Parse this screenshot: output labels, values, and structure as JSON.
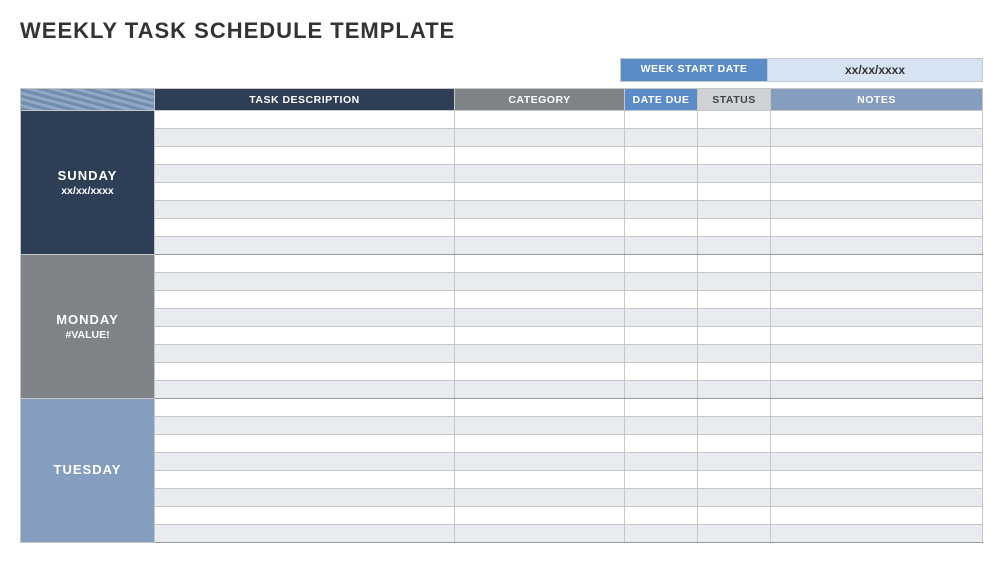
{
  "title": "WEEKLY TASK SCHEDULE TEMPLATE",
  "week_start": {
    "label": "WEEK START DATE",
    "value": "xx/xx/xxxx"
  },
  "columns": {
    "task_description": "TASK DESCRIPTION",
    "category": "CATEGORY",
    "date_due": "DATE DUE",
    "status": "STATUS",
    "notes": "NOTES"
  },
  "days": [
    {
      "name": "SUNDAY",
      "date": "xx/xx/xxxx",
      "bg_class": "bg-sunday",
      "rows": [
        {
          "task_description": "",
          "category": "",
          "date_due": "",
          "status": "",
          "notes": ""
        },
        {
          "task_description": "",
          "category": "",
          "date_due": "",
          "status": "",
          "notes": ""
        },
        {
          "task_description": "",
          "category": "",
          "date_due": "",
          "status": "",
          "notes": ""
        },
        {
          "task_description": "",
          "category": "",
          "date_due": "",
          "status": "",
          "notes": ""
        },
        {
          "task_description": "",
          "category": "",
          "date_due": "",
          "status": "",
          "notes": ""
        },
        {
          "task_description": "",
          "category": "",
          "date_due": "",
          "status": "",
          "notes": ""
        },
        {
          "task_description": "",
          "category": "",
          "date_due": "",
          "status": "",
          "notes": ""
        },
        {
          "task_description": "",
          "category": "",
          "date_due": "",
          "status": "",
          "notes": ""
        }
      ]
    },
    {
      "name": "MONDAY",
      "date": "#VALUE!",
      "bg_class": "bg-monday",
      "rows": [
        {
          "task_description": "",
          "category": "",
          "date_due": "",
          "status": "",
          "notes": ""
        },
        {
          "task_description": "",
          "category": "",
          "date_due": "",
          "status": "",
          "notes": ""
        },
        {
          "task_description": "",
          "category": "",
          "date_due": "",
          "status": "",
          "notes": ""
        },
        {
          "task_description": "",
          "category": "",
          "date_due": "",
          "status": "",
          "notes": ""
        },
        {
          "task_description": "",
          "category": "",
          "date_due": "",
          "status": "",
          "notes": ""
        },
        {
          "task_description": "",
          "category": "",
          "date_due": "",
          "status": "",
          "notes": ""
        },
        {
          "task_description": "",
          "category": "",
          "date_due": "",
          "status": "",
          "notes": ""
        },
        {
          "task_description": "",
          "category": "",
          "date_due": "",
          "status": "",
          "notes": ""
        }
      ]
    },
    {
      "name": "TUESDAY",
      "date": "",
      "bg_class": "bg-tuesday",
      "rows": [
        {
          "task_description": "",
          "category": "",
          "date_due": "",
          "status": "",
          "notes": ""
        },
        {
          "task_description": "",
          "category": "",
          "date_due": "",
          "status": "",
          "notes": ""
        },
        {
          "task_description": "",
          "category": "",
          "date_due": "",
          "status": "",
          "notes": ""
        },
        {
          "task_description": "",
          "category": "",
          "date_due": "",
          "status": "",
          "notes": ""
        },
        {
          "task_description": "",
          "category": "",
          "date_due": "",
          "status": "",
          "notes": ""
        },
        {
          "task_description": "",
          "category": "",
          "date_due": "",
          "status": "",
          "notes": ""
        },
        {
          "task_description": "",
          "category": "",
          "date_due": "",
          "status": "",
          "notes": ""
        },
        {
          "task_description": "",
          "category": "",
          "date_due": "",
          "status": "",
          "notes": ""
        }
      ]
    }
  ]
}
